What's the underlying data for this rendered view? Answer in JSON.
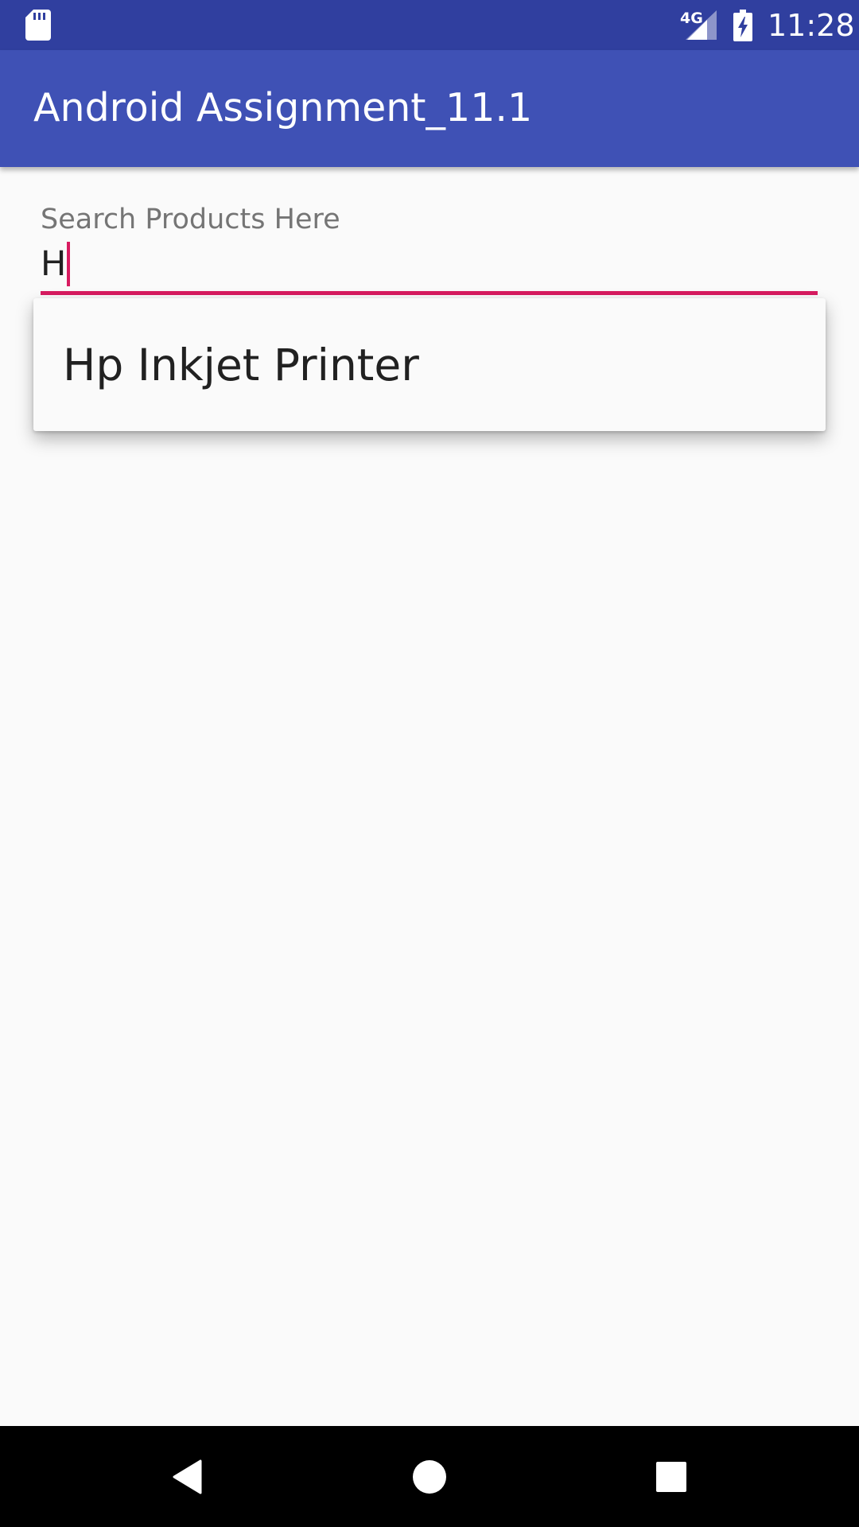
{
  "status_bar": {
    "network_type": "4G",
    "time": "11:28",
    "icons": [
      "sd-card-icon",
      "cell-signal-icon",
      "battery-charging-icon"
    ]
  },
  "app_bar": {
    "title": "Android Assignment_11.1",
    "color": "#3F51B5"
  },
  "search": {
    "label": "Search Products Here",
    "value": "H",
    "accent_color": "#D81B60"
  },
  "suggestions": [
    {
      "label": "Hp Inkjet Printer"
    }
  ],
  "nav_bar": {
    "icons": [
      "back-icon",
      "home-icon",
      "recents-icon"
    ]
  },
  "colors": {
    "status_bar": "#303F9F",
    "primary": "#3F51B5",
    "accent": "#D81B60",
    "background": "#FAFAFA"
  }
}
